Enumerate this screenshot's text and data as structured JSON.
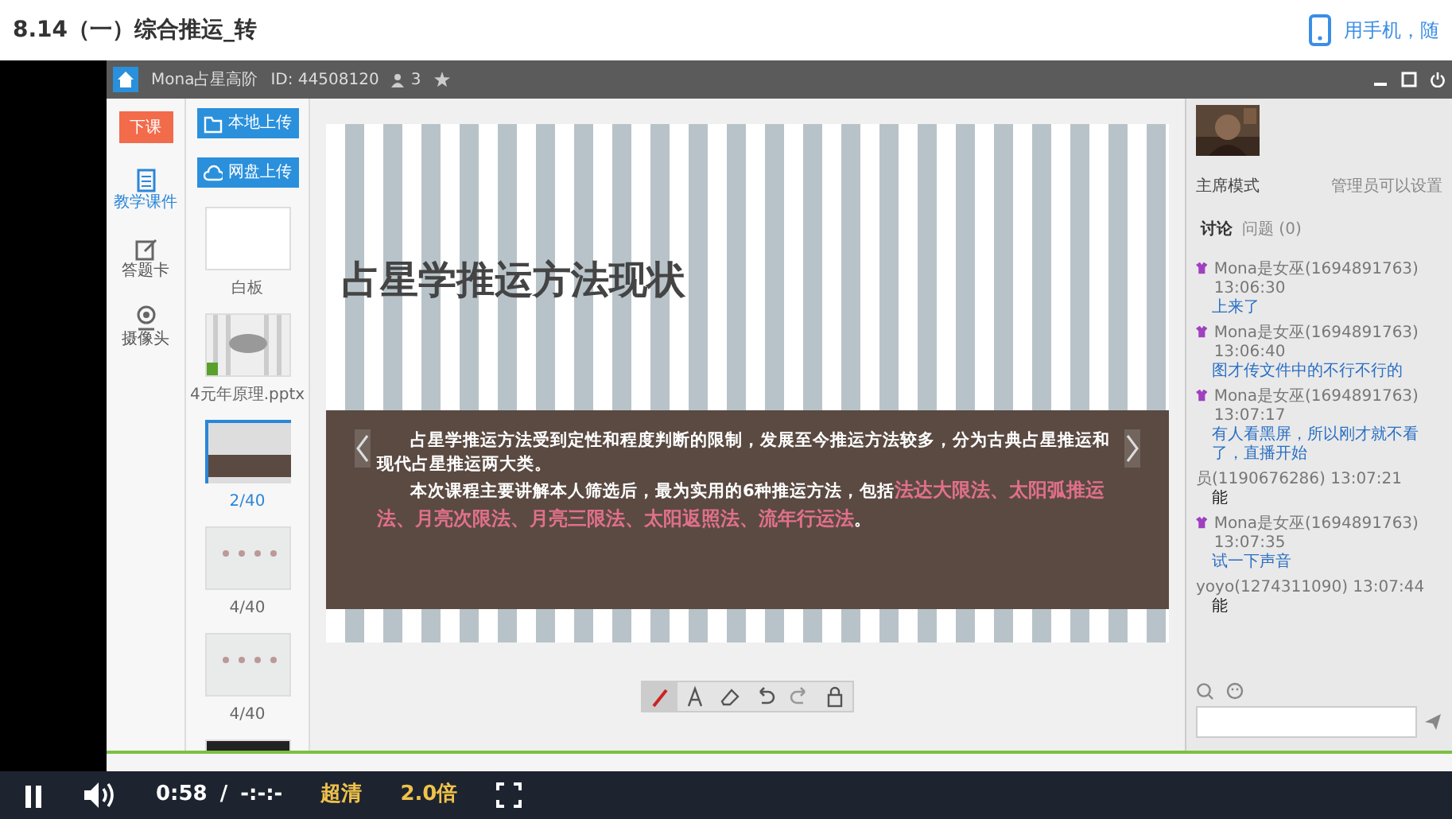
{
  "page_title": "8.14（一）综合推运_转",
  "mobile_link": "用手机，随",
  "app": {
    "title": "Mona占星高阶",
    "room_id": "ID: 44508120",
    "members": "3",
    "end_class": "下课",
    "nav": [
      {
        "label": "教学课件",
        "kind": "courseware",
        "selected": true
      },
      {
        "label": "答题卡",
        "kind": "answer",
        "selected": false
      },
      {
        "label": "摄像头",
        "kind": "camera",
        "selected": false
      }
    ],
    "upload_buttons": [
      {
        "label": "本地上传",
        "kind": "local"
      },
      {
        "label": "网盘上传",
        "kind": "cloud"
      }
    ],
    "thumbnails": [
      {
        "label": "白板",
        "kind": "blank",
        "selected": false
      },
      {
        "label": "4元年原理.pptx",
        "kind": "cover",
        "selected": false
      },
      {
        "label": "2/40",
        "kind": "brown",
        "selected": true
      },
      {
        "label": "4/40",
        "kind": "light",
        "selected": false
      },
      {
        "label": "4/40",
        "kind": "light",
        "selected": false
      },
      {
        "kind": "dark",
        "selected": false
      }
    ],
    "slide": {
      "title": "占星学推运方法现状",
      "paragraphs": [
        [
          {
            "text": "占星学推运方法受到定性和程度判断的限制，发展至今推运方法较多，分为古典占星推运和现代占星推运两大类。",
            "highlight": false
          }
        ],
        [
          {
            "text": "本次课程主要讲解本人筛选后，最为实用的6种推运方法，包括",
            "highlight": false
          },
          {
            "text": "法达大限法、太阳弧推运法、月亮次限法、月亮三限法、太阳返照法、流年行运法",
            "highlight": true
          },
          {
            "text": "。",
            "highlight": false
          }
        ]
      ]
    },
    "tools": [
      {
        "kind": "pen",
        "selected": true
      },
      {
        "kind": "text",
        "selected": false
      },
      {
        "kind": "eraser",
        "selected": false
      },
      {
        "kind": "undo",
        "selected": false
      },
      {
        "kind": "redo",
        "selected": false
      },
      {
        "kind": "lock",
        "selected": false
      }
    ],
    "mode": "主席模式",
    "mode_note": "管理员可以设置",
    "tabs": [
      {
        "label": "讨论",
        "selected": true
      },
      {
        "label": "问题 (0)",
        "selected": false
      }
    ],
    "messages": [
      {
        "sender": "Mona是女巫(1694891763) 13:06:30",
        "text": "上来了",
        "kind": "teacher"
      },
      {
        "sender": "Mona是女巫(1694891763) 13:06:40",
        "text": "图才传文件中的不行不行的",
        "kind": "teacher"
      },
      {
        "sender": "Mona是女巫(1694891763) 13:07:17",
        "text": "有人看黑屏，所以刚才就不看了，直播开始",
        "kind": "teacher"
      },
      {
        "sender": "员(1190676286) 13:07:21",
        "text": "能",
        "kind": "student"
      },
      {
        "sender": "Mona是女巫(1694891763) 13:07:35",
        "text": "试一下声音",
        "kind": "teacher"
      },
      {
        "sender": "yoyo(1274311090) 13:07:44",
        "text": "能",
        "kind": "student"
      }
    ]
  },
  "player": {
    "playing": true,
    "time": "0:58",
    "separator": "/",
    "duration": "-:-:-",
    "quality": "超清",
    "speed": "2.0倍"
  }
}
